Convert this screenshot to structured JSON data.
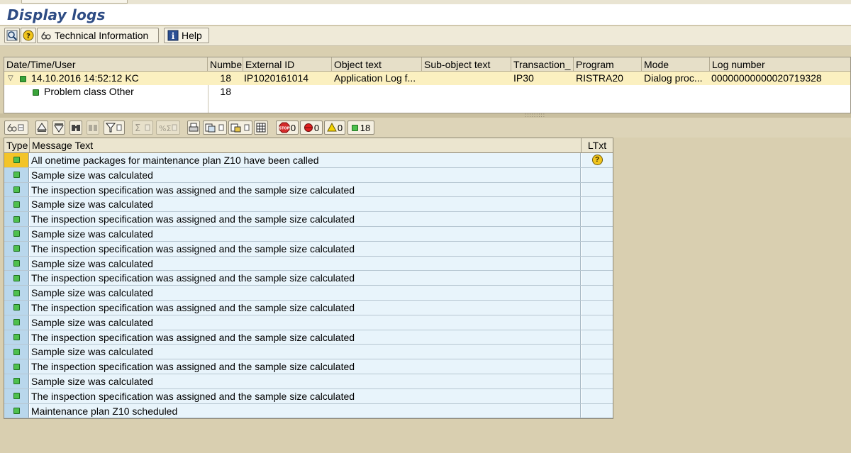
{
  "window": {
    "title": "Display logs"
  },
  "app_toolbar": {
    "tech_info_label": "Technical Information",
    "help_label": "Help"
  },
  "log_tree": {
    "columns": [
      "Date/Time/User",
      "Numbe",
      "External ID",
      "Object text",
      "Sub-object text",
      "Transaction_",
      "Program",
      "Mode",
      "Log number"
    ],
    "row1": {
      "datetime_user": "14.10.2016  14:52:12  KC",
      "number": "18",
      "external_id": "IP1020161014",
      "object_text": "Application Log f...",
      "sub_object_text": "",
      "transaction": "IP30",
      "program": "RISTRA20",
      "mode": "Dialog proc...",
      "log_number": "00000000000020719328"
    },
    "row2": {
      "label": "Problem class Other",
      "number": "18"
    }
  },
  "alv_toolbar": {
    "counts": {
      "stop": "0",
      "error": "0",
      "warning": "0",
      "success": "18"
    }
  },
  "message_grid": {
    "headers": {
      "type": "Type",
      "text": "Message Text",
      "ltxt": "LTxt"
    },
    "rows": [
      {
        "text": "All onetime packages for maintenance plan Z10 have been called",
        "type": "success",
        "highlight": true,
        "long_text": true
      },
      {
        "text": "Sample size was calculated",
        "type": "success"
      },
      {
        "text": "The inspection specification was assigned and the sample size calculated",
        "type": "success"
      },
      {
        "text": "Sample size was calculated",
        "type": "success"
      },
      {
        "text": "The inspection specification was assigned and the sample size calculated",
        "type": "success"
      },
      {
        "text": "Sample size was calculated",
        "type": "success"
      },
      {
        "text": "The inspection specification was assigned and the sample size calculated",
        "type": "success"
      },
      {
        "text": "Sample size was calculated",
        "type": "success"
      },
      {
        "text": "The inspection specification was assigned and the sample size calculated",
        "type": "success"
      },
      {
        "text": "Sample size was calculated",
        "type": "success"
      },
      {
        "text": "The inspection specification was assigned and the sample size calculated",
        "type": "success"
      },
      {
        "text": "Sample size was calculated",
        "type": "success"
      },
      {
        "text": "The inspection specification was assigned and the sample size calculated",
        "type": "success"
      },
      {
        "text": "Sample size was calculated",
        "type": "success"
      },
      {
        "text": "The inspection specification was assigned and the sample size calculated",
        "type": "success"
      },
      {
        "text": "Sample size was calculated",
        "type": "success"
      },
      {
        "text": "The inspection specification was assigned and the sample size calculated",
        "type": "success"
      },
      {
        "text": "Maintenance plan Z10 scheduled",
        "type": "success"
      }
    ]
  }
}
